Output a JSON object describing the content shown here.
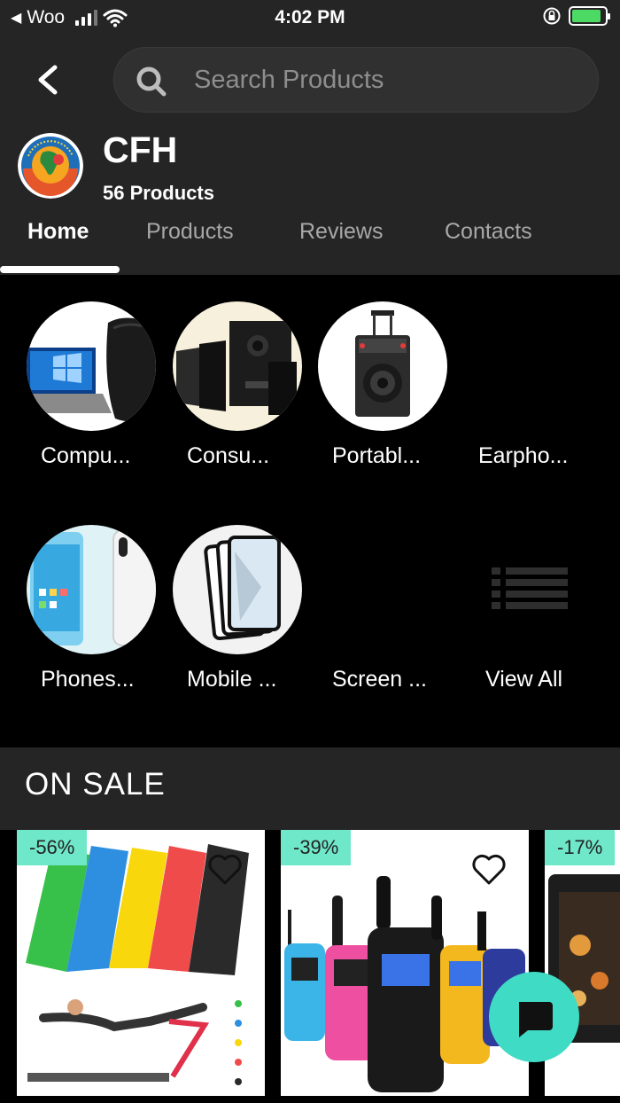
{
  "status_bar": {
    "carrier": "Woo",
    "time": "4:02 PM",
    "battery_level": 0.9,
    "signal_bars": 3
  },
  "header": {
    "search_placeholder": "Search Products",
    "store_name": "CFH",
    "store_count": "56 Products"
  },
  "tabs": [
    {
      "label": "Home",
      "active": true
    },
    {
      "label": "Products",
      "active": false
    },
    {
      "label": "Reviews",
      "active": false
    },
    {
      "label": "Contacts",
      "active": false
    }
  ],
  "categories": [
    {
      "label": "Compu...",
      "icon": "laptop-bag-image"
    },
    {
      "label": "Consu...",
      "icon": "speaker-set-image"
    },
    {
      "label": "Portabl...",
      "icon": "party-speaker-image"
    },
    {
      "label": "Earpho...",
      "icon": "none"
    },
    {
      "label": "Phones...",
      "icon": "phones-image"
    },
    {
      "label": "Mobile ...",
      "icon": "screen-protector-image"
    },
    {
      "label": "Screen ...",
      "icon": "none"
    },
    {
      "label": "View All",
      "icon": "list-icon"
    }
  ],
  "sale": {
    "title": "ON SALE",
    "products": [
      {
        "discount": "-56%",
        "image": "resistance-bands-image"
      },
      {
        "discount": "-39%",
        "image": "walkie-talkies-image"
      },
      {
        "discount": "-17%",
        "image": "air-fryer-oven-image"
      }
    ]
  },
  "colors": {
    "accent": "#3fdbc4",
    "badge": "#6fe7c9",
    "header_bg": "#252525",
    "body_bg": "#000000"
  }
}
